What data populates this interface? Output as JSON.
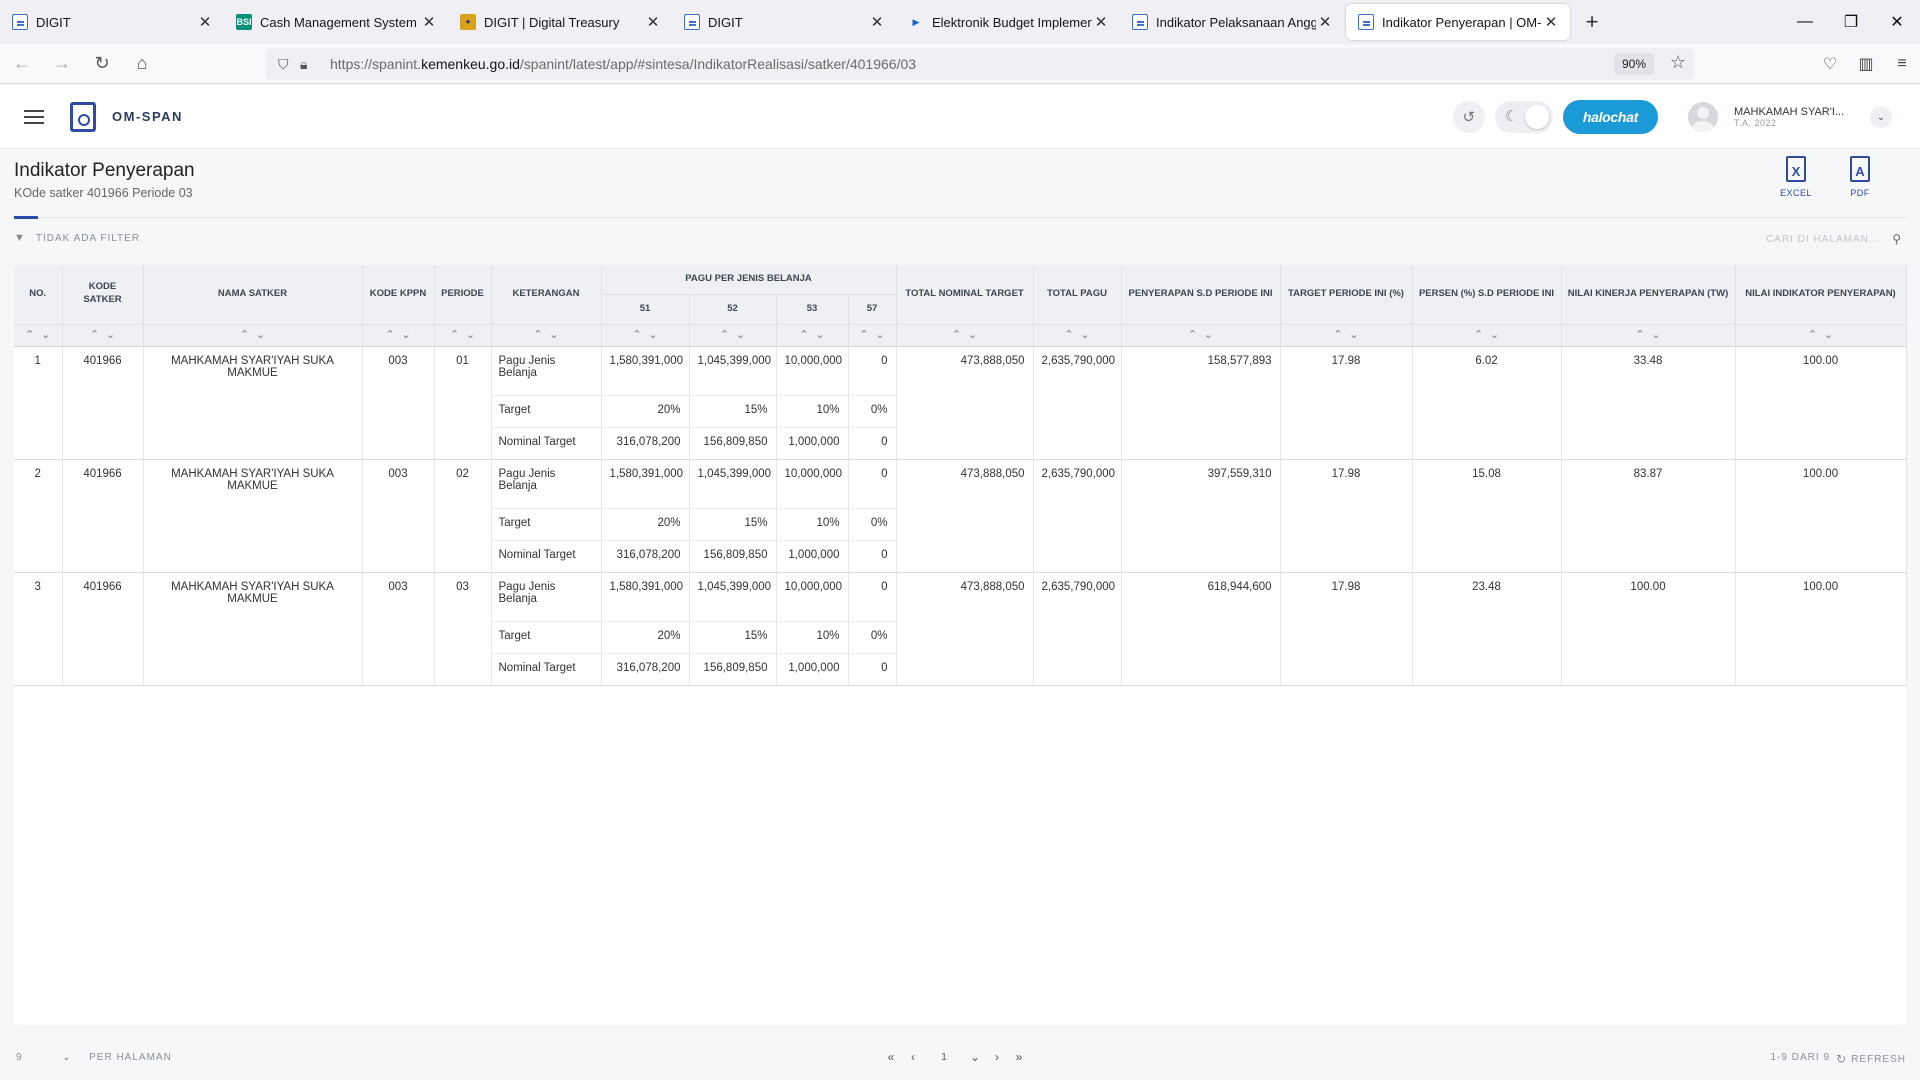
{
  "browser": {
    "tabs": [
      {
        "title": "DIGIT",
        "icon": "doc-icon"
      },
      {
        "title": "Cash Management System - Ba",
        "icon": "bsi-icon"
      },
      {
        "title": "DIGIT | Digital Treasury",
        "icon": "kemenkeu-icon"
      },
      {
        "title": "DIGIT",
        "icon": "doc-icon"
      },
      {
        "title": "Elektronik Budget Implementati",
        "icon": "play-icon"
      },
      {
        "title": "Indikator Pelaksanaan Anggaran",
        "icon": "doc-icon"
      },
      {
        "title": "Indikator Penyerapan | OM-SPA",
        "icon": "doc-icon"
      }
    ],
    "url_prefix": "https://spanint.",
    "url_domain": "kemenkeu.go.id",
    "url_path": "/spanint/latest/app/#sintesa/IndikatorRealisasi/satker/401966/03",
    "zoom": "90%"
  },
  "app": {
    "name": "OM-SPAN",
    "halo_label": "halochat",
    "user_name": "MAHKAMAH SYAR'I...",
    "user_year": "T.A. 2022"
  },
  "page": {
    "title": "Indikator Penyerapan",
    "subtitle": "KOde satker 401966 Periode 03",
    "excel_label": "EXCEL",
    "pdf_label": "PDF",
    "filter_label": "TIDAK ADA FILTER",
    "search_placeholder": "CARI DI HALAMAN..."
  },
  "table": {
    "headers": {
      "no": "NO.",
      "kode_satker": "KODE SATKER",
      "nama_satker": "NAMA SATKER",
      "kode_kppn": "KODE KPPN",
      "periode": "PERIODE",
      "keterangan": "KETERANGAN",
      "pagu_group": "PAGU PER JENIS BELANJA",
      "c51": "51",
      "c52": "52",
      "c53": "53",
      "c57": "57",
      "total_nominal_target": "TOTAL NOMINAL TARGET",
      "total_pagu": "TOTAL PAGU",
      "penyerapan": "PENYERAPAN S.D PERIODE INI",
      "target_periode": "TARGET PERIODE INI (%)",
      "persen": "PERSEN (%) S.D PERIODE INI",
      "nilai_kinerja": "NILAI KINERJA PENYERAPAN (TW)",
      "nilai_indikator": "NILAI INDIKATOR PENYERAPAN)"
    },
    "rows": [
      {
        "no": "1",
        "kode_satker": "401966",
        "nama_satker": "MAHKAMAH SYAR'IYAH SUKA MAKMUE",
        "kode_kppn": "003",
        "periode": "01",
        "lines": [
          {
            "ket": "Pagu Jenis Belanja",
            "v51": "1,580,391,000",
            "v52": "1,045,399,000",
            "v53": "10,000,000",
            "v57": "0"
          },
          {
            "ket": "Target",
            "v51": "20%",
            "v52": "15%",
            "v53": "10%",
            "v57": "0%"
          },
          {
            "ket": "Nominal Target",
            "v51": "316,078,200",
            "v52": "156,809,850",
            "v53": "1,000,000",
            "v57": "0"
          }
        ],
        "total_nominal_target": "473,888,050",
        "total_pagu": "2,635,790,000",
        "penyerapan": "158,577,893",
        "target_periode": "17.98",
        "persen": "6.02",
        "nilai_kinerja": "33.48",
        "nilai_indikator": "100.00"
      },
      {
        "no": "2",
        "kode_satker": "401966",
        "nama_satker": "MAHKAMAH SYAR'IYAH SUKA MAKMUE",
        "kode_kppn": "003",
        "periode": "02",
        "lines": [
          {
            "ket": "Pagu Jenis Belanja",
            "v51": "1,580,391,000",
            "v52": "1,045,399,000",
            "v53": "10,000,000",
            "v57": "0"
          },
          {
            "ket": "Target",
            "v51": "20%",
            "v52": "15%",
            "v53": "10%",
            "v57": "0%"
          },
          {
            "ket": "Nominal Target",
            "v51": "316,078,200",
            "v52": "156,809,850",
            "v53": "1,000,000",
            "v57": "0"
          }
        ],
        "total_nominal_target": "473,888,050",
        "total_pagu": "2,635,790,000",
        "penyerapan": "397,559,310",
        "target_periode": "17.98",
        "persen": "15.08",
        "nilai_kinerja": "83.87",
        "nilai_indikator": "100.00"
      },
      {
        "no": "3",
        "kode_satker": "401966",
        "nama_satker": "MAHKAMAH SYAR'IYAH SUKA MAKMUE",
        "kode_kppn": "003",
        "periode": "03",
        "lines": [
          {
            "ket": "Pagu Jenis Belanja",
            "v51": "1,580,391,000",
            "v52": "1,045,399,000",
            "v53": "10,000,000",
            "v57": "0"
          },
          {
            "ket": "Target",
            "v51": "20%",
            "v52": "15%",
            "v53": "10%",
            "v57": "0%"
          },
          {
            "ket": "Nominal Target",
            "v51": "316,078,200",
            "v52": "156,809,850",
            "v53": "1,000,000",
            "v57": "0"
          }
        ],
        "total_nominal_target": "473,888,050",
        "total_pagu": "2,635,790,000",
        "penyerapan": "618,944,600",
        "target_periode": "17.98",
        "persen": "23.48",
        "nilai_kinerja": "100.00",
        "nilai_indikator": "100.00"
      }
    ]
  },
  "footer": {
    "per_page_value": "9",
    "per_page_label": "PER HALAMAN",
    "current_page": "1",
    "total_label": "1-9 DARI 9",
    "refresh_label": "REFRESH"
  }
}
